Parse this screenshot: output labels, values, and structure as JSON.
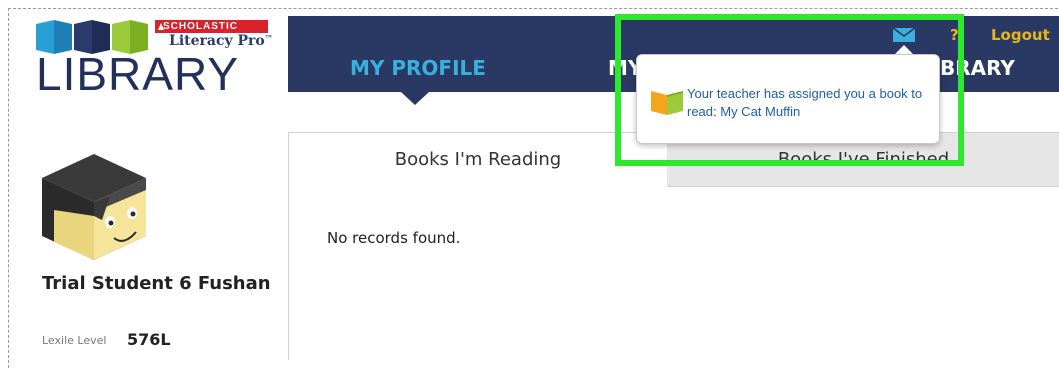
{
  "logo": {
    "badge": "SCHOLASTIC",
    "subtitle": "Literacy Pro",
    "tm": "™",
    "wordmark": "LIBRARY"
  },
  "nav": {
    "items": [
      "MY PROFILE",
      "MY",
      "BRARY"
    ],
    "help": "?",
    "logout": "Logout"
  },
  "profile": {
    "name": "Trial Student 6 Fushan",
    "lexile_label": "Lexile Level",
    "lexile_value": "576L"
  },
  "tabs": {
    "reading": "Books I'm Reading",
    "finished": "Books I've Finished"
  },
  "content": {
    "empty_message": "No records found."
  },
  "notification": {
    "message": "Your teacher has assigned you a book to read: My Cat Muffin"
  },
  "colors": {
    "navy": "#2a3963",
    "accent_blue": "#39b0dd",
    "gold": "#e6b51a",
    "highlight_green": "#2ee82e",
    "link_blue": "#1f5fa8"
  },
  "icons": [
    "books-logo-icon",
    "mail-icon",
    "avatar",
    "book-icon"
  ]
}
